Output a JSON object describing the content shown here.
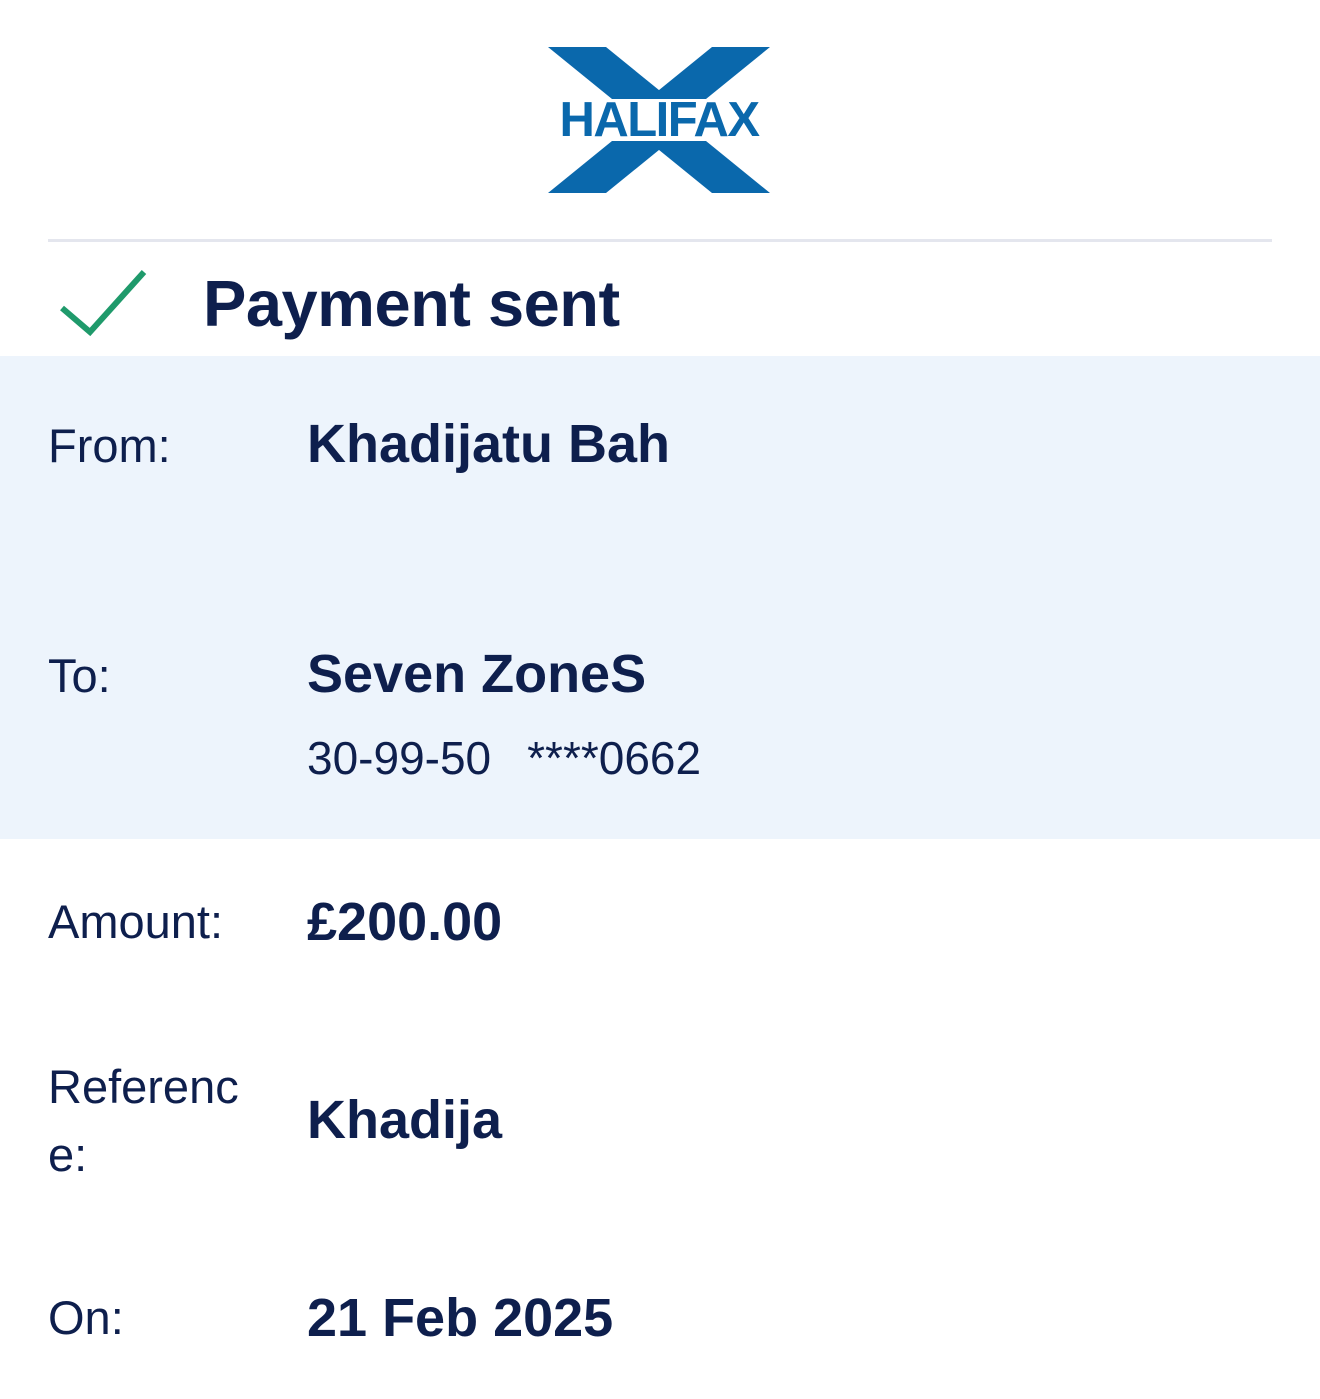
{
  "brand": {
    "name": "HALIFAX",
    "primary_color": "#0a68ac",
    "text_color": "#0e1f4d",
    "success_color": "#1f9a6b",
    "band_color": "#edf4fc"
  },
  "status": {
    "icon": "check-icon",
    "title": "Payment sent"
  },
  "details": {
    "from": {
      "label": "From:",
      "value": "Khadijatu Bah"
    },
    "to": {
      "label": "To:",
      "value": "Seven ZoneS",
      "sort_code": "30-99-50",
      "account": "****0662"
    },
    "amount": {
      "label": "Amount:",
      "value": "£200.00"
    },
    "reference": {
      "label": "Reference:",
      "value": "Khadija"
    },
    "on": {
      "label": "On:",
      "value": "21 Feb 2025"
    }
  }
}
